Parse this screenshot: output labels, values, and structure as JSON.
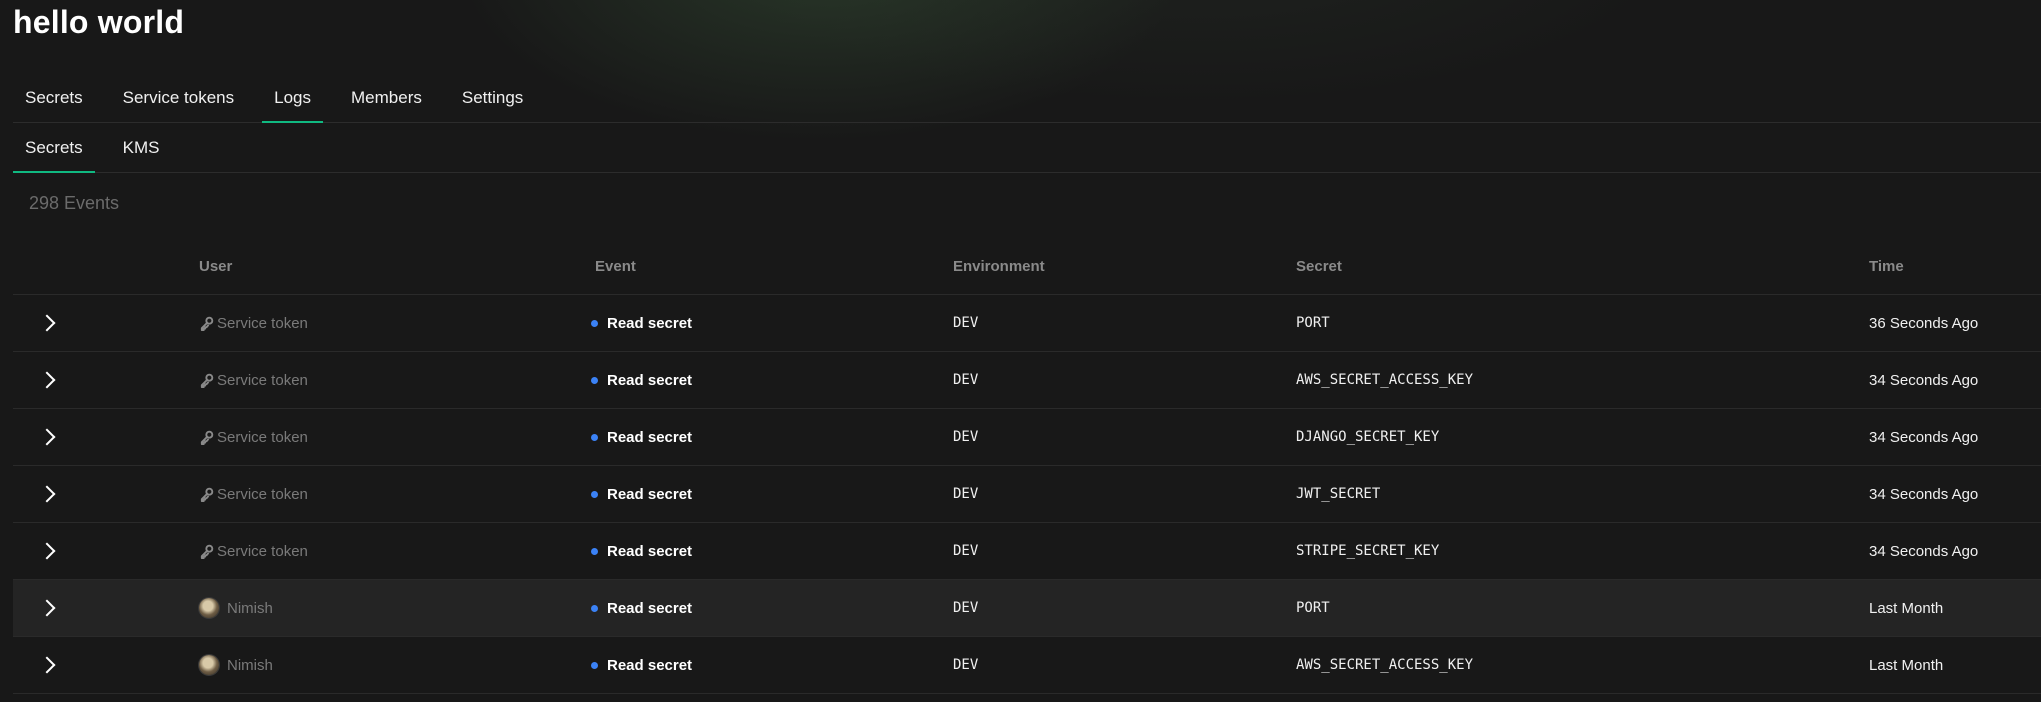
{
  "app": {
    "title": "hello world"
  },
  "tabs": [
    {
      "label": "Secrets",
      "active": false
    },
    {
      "label": "Service tokens",
      "active": false
    },
    {
      "label": "Logs",
      "active": true
    },
    {
      "label": "Members",
      "active": false
    },
    {
      "label": "Settings",
      "active": false
    }
  ],
  "subtabs": [
    {
      "label": "Secrets",
      "active": true
    },
    {
      "label": "KMS",
      "active": false
    }
  ],
  "logs": {
    "event_count": "298 Events",
    "columns": {
      "user": "User",
      "event": "Event",
      "environment": "Environment",
      "secret": "Secret",
      "time": "Time"
    },
    "rows": [
      {
        "user": "Service token",
        "user_type": "service-token",
        "event": "Read secret",
        "environment": "DEV",
        "secret": "PORT",
        "time": "36 Seconds Ago"
      },
      {
        "user": "Service token",
        "user_type": "service-token",
        "event": "Read secret",
        "environment": "DEV",
        "secret": "AWS_SECRET_ACCESS_KEY",
        "time": "34 Seconds Ago"
      },
      {
        "user": "Service token",
        "user_type": "service-token",
        "event": "Read secret",
        "environment": "DEV",
        "secret": "DJANGO_SECRET_KEY",
        "time": "34 Seconds Ago"
      },
      {
        "user": "Service token",
        "user_type": "service-token",
        "event": "Read secret",
        "environment": "DEV",
        "secret": "JWT_SECRET",
        "time": "34 Seconds Ago"
      },
      {
        "user": "Service token",
        "user_type": "service-token",
        "event": "Read secret",
        "environment": "DEV",
        "secret": "STRIPE_SECRET_KEY",
        "time": "34 Seconds Ago"
      },
      {
        "user": "Nimish",
        "user_type": "member",
        "event": "Read secret",
        "environment": "DEV",
        "secret": "PORT",
        "time": "Last Month"
      },
      {
        "user": "Nimish",
        "user_type": "member",
        "event": "Read secret",
        "environment": "DEV",
        "secret": "AWS_SECRET_ACCESS_KEY",
        "time": "Last Month"
      }
    ]
  },
  "icons": {
    "expand": "chevron-right-icon",
    "service_token": "key-icon",
    "member": "avatar",
    "event_status": "status-dot-icon"
  },
  "colors": {
    "accent": "#10b981",
    "event_dot": "#3b82f6",
    "background": "#181818"
  }
}
